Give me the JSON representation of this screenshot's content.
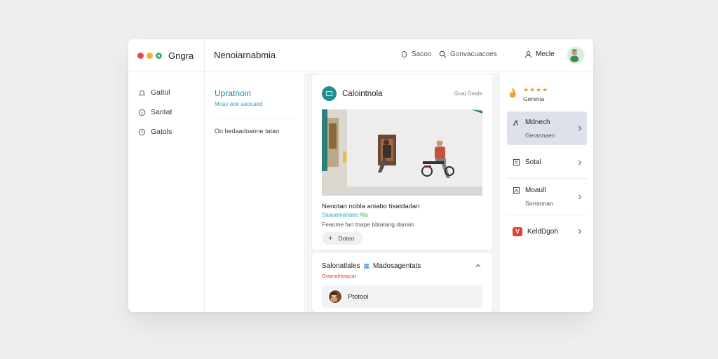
{
  "app": {
    "name": "Gngra",
    "title": "Nenoiarnabmia"
  },
  "topbar": {
    "item1": {
      "icon": "lock-icon",
      "label": "Sacoo"
    },
    "item2": {
      "icon": "search-icon",
      "label": "Gonvacuacoes"
    },
    "item3": {
      "icon": "user-icon",
      "label": "Mecle"
    }
  },
  "sidebar": {
    "items": [
      {
        "icon": "bell-icon",
        "label": "Gatlul"
      },
      {
        "icon": "info-icon",
        "label": "Santat"
      },
      {
        "icon": "clock-icon",
        "label": "Gatols"
      }
    ]
  },
  "list": {
    "title": "Upratnoin",
    "subtitle": "Moay aoe aaooaed",
    "text": "Oo bedaadoaone tatan"
  },
  "feed": {
    "post": {
      "channel": "Calointnola",
      "meta": "Goal  Geale",
      "headline": "Nenotan nobla aniabo tisatdadan",
      "link": "Saaoamanaee",
      "link_tag": "Ala",
      "description": "Feaome fan tnape bblatang danain",
      "action_label": "Doteo"
    },
    "card2": {
      "title": "Salonatlales",
      "badge": "Madosagentats",
      "subtitle": "Goanahtoaciat",
      "row_label": "Ptotool"
    }
  },
  "right": {
    "rating": {
      "stars": "★★★★",
      "label": "Gerenia"
    },
    "items": [
      {
        "icon": "kick-scooter-icon",
        "label": "Mdnech",
        "sub": "Gerannaen"
      },
      {
        "icon": "document-icon",
        "label": "Sotal",
        "sub": ""
      },
      {
        "icon": "image-icon",
        "label": "Moaull",
        "sub": "Sarrannan"
      },
      {
        "icon": "v-badge-icon",
        "badge": "V",
        "label": "KeldDgoh",
        "sub": ""
      }
    ]
  },
  "colors": {
    "accent_teal": "#1b8aa0",
    "red": "#e0412f",
    "star": "#e9a23b",
    "active_bg": "#dde1ea"
  }
}
